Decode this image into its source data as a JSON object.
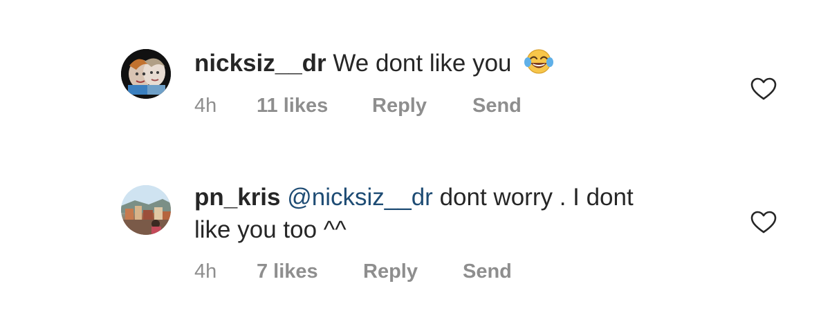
{
  "comments": [
    {
      "username": "nicksiz__dr",
      "text": "We dont like you",
      "emoji": "face-with-tears-of-joy",
      "time": "4h",
      "likes": "11 likes",
      "reply_label": "Reply",
      "send_label": "Send"
    },
    {
      "username": "pn_kris",
      "mention": "@nicksiz__dr",
      "text_line1": "dont worry . I dont",
      "text_line2": "like you too ^^",
      "time": "4h",
      "likes": "7 likes",
      "reply_label": "Reply",
      "send_label": "Send"
    }
  ],
  "icons": {
    "like": "heart-outline-icon"
  },
  "colors": {
    "text": "#262626",
    "secondary": "#8e8e8e",
    "mention": "#1e4c74",
    "background": "#ffffff"
  }
}
